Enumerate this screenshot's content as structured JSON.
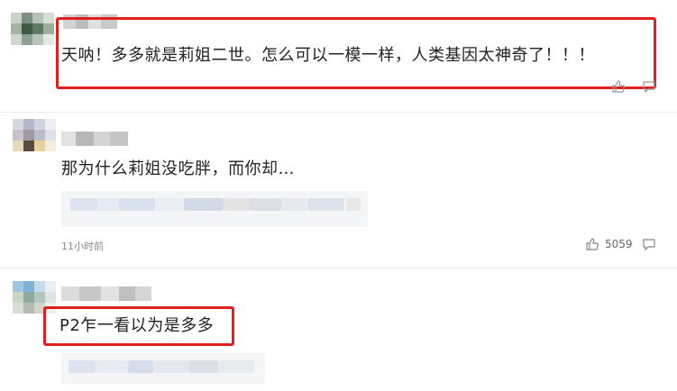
{
  "comments": [
    {
      "text": "天呐！多多就是莉姐二世。怎么可以一模一样，人类基因太神奇了！！！"
    },
    {
      "text": "那为什么莉姐没吃胖，而你却…",
      "time": "11小时前",
      "likes": "5059"
    },
    {
      "text": "P2乍一看以为是多多"
    }
  ],
  "colors": {
    "highlight_border": "#e02020",
    "text": "#222222",
    "meta_text": "#8a8a8a"
  }
}
